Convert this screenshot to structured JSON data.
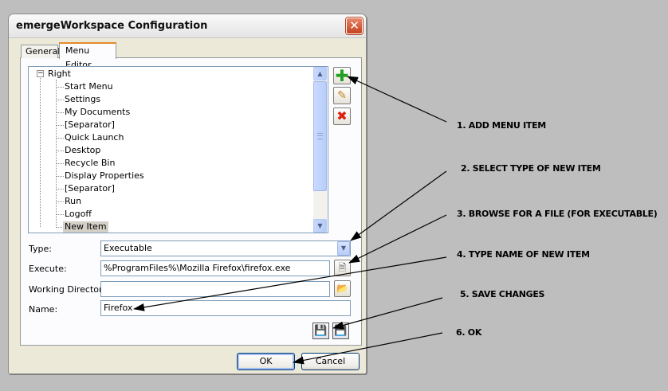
{
  "window": {
    "title": "emergeWorkspace Configuration",
    "close_glyph": "✕"
  },
  "tabs": [
    {
      "label": "General"
    },
    {
      "label": "Menu Editor"
    }
  ],
  "tree": {
    "root": "Right",
    "expander": "−",
    "items": [
      "Start Menu",
      "Settings",
      "My Documents",
      "[Separator]",
      "Quick Launch",
      "Desktop",
      "Recycle Bin",
      "Display Properties",
      "[Separator]",
      "Run",
      "Logoff",
      "New Item"
    ],
    "selected": "New Item"
  },
  "scrollbar": {
    "up": "▲",
    "down": "▼"
  },
  "side_buttons": {
    "add_icon": "add-icon",
    "add_glyph": "✚",
    "edit_icon": "pencil-icon",
    "edit_glyph": "✎",
    "delete_icon": "delete-icon",
    "delete_glyph": "✖"
  },
  "form": {
    "type_label": "Type:",
    "type_value": "Executable",
    "dropdown_glyph": "▼",
    "execute_label": "Execute:",
    "execute_value": "%ProgramFiles%\\Mozilla Firefox\\firefox.exe",
    "browse_file_glyph": "🗎",
    "workdir_label": "Working Directory:",
    "workdir_value": "",
    "browse_folder_glyph": "📂",
    "name_label": "Name:",
    "name_value": "Firefox"
  },
  "save_buttons": {
    "save_glyph": "💾",
    "save_as_glyph": "💾"
  },
  "buttons": {
    "ok": "OK",
    "cancel": "Cancel"
  },
  "callouts": [
    "1.  ADD MENU ITEM",
    "2.  SELECT TYPE OF NEW ITEM",
    "3.  BROWSE FOR A FILE (FOR EXECUTABLE)",
    "4.  TYPE NAME OF NEW ITEM",
    "5.  SAVE CHANGES",
    "6.  OK"
  ]
}
